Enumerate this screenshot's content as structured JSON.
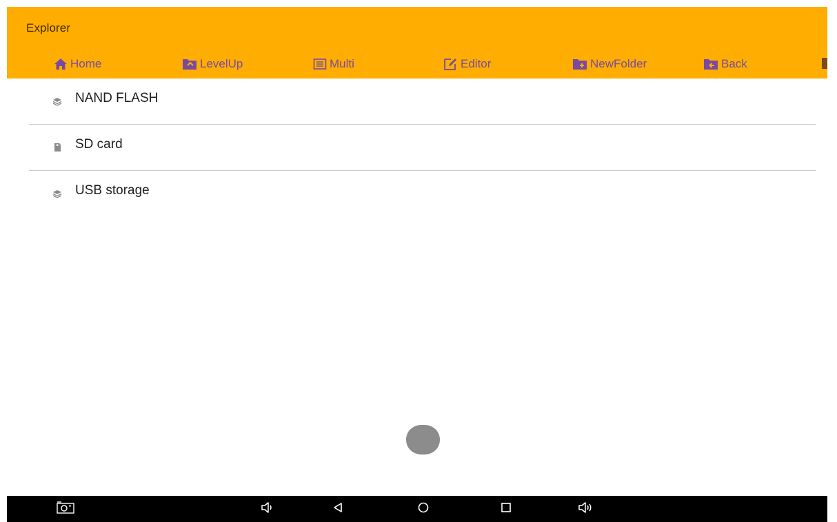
{
  "app": {
    "title": "Explorer"
  },
  "toolbar": {
    "buttons": [
      {
        "label": "Home",
        "icon": "home-icon"
      },
      {
        "label": "LevelUp",
        "icon": "folder-up-icon"
      },
      {
        "label": "Multi",
        "icon": "multi-select-icon"
      },
      {
        "label": "Editor",
        "icon": "edit-icon"
      },
      {
        "label": "NewFolder",
        "icon": "new-folder-icon"
      },
      {
        "label": "Back",
        "icon": "folder-back-icon"
      }
    ]
  },
  "storage_list": {
    "items": [
      {
        "label": "NAND FLASH",
        "icon": "storage-stack-icon"
      },
      {
        "label": "SD card",
        "icon": "sd-card-icon"
      },
      {
        "label": "USB storage",
        "icon": "storage-stack-icon"
      }
    ]
  },
  "navbar": {
    "buttons": [
      {
        "icon": "screenshot-icon"
      },
      {
        "icon": "volume-down-icon"
      },
      {
        "icon": "back-icon"
      },
      {
        "icon": "home-circle-icon"
      },
      {
        "icon": "recents-icon"
      },
      {
        "icon": "volume-up-icon"
      }
    ]
  },
  "colors": {
    "header_bg": "#ffad01",
    "toolbar_text": "#7a4aa0",
    "navbar_bg": "#000000",
    "fab": "#8c8c8c"
  }
}
